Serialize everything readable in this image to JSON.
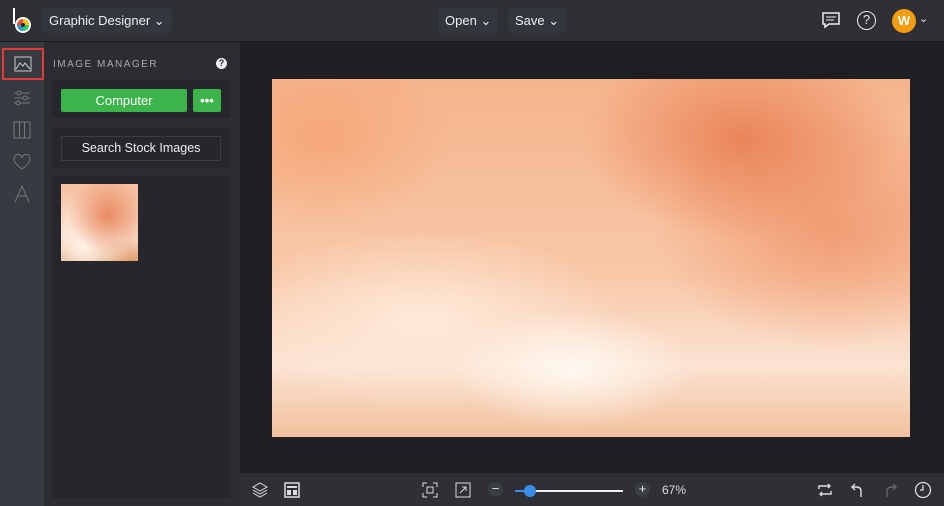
{
  "header": {
    "project": "Graphic Designer",
    "open_label": "Open",
    "save_label": "Save",
    "avatar_initial": "W"
  },
  "panel": {
    "title": "IMAGE MANAGER",
    "computer_label": "Computer",
    "more_label": "•••",
    "search_stock_label": "Search Stock Images"
  },
  "footer": {
    "zoom_text": "67%",
    "zoom_percent": 67,
    "zoom_slider_fraction": 0.14
  },
  "colors": {
    "accent_green": "#3bb54a",
    "active_red": "#e53935",
    "avatar": "#f39c12",
    "slider": "#3b8ee8"
  }
}
